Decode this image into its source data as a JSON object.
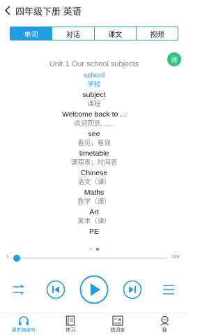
{
  "header": {
    "title": "四年级下册 英语"
  },
  "tabs": [
    {
      "label": "单词",
      "active": true
    },
    {
      "label": "对话",
      "active": false
    },
    {
      "label": "课文",
      "active": false
    },
    {
      "label": "视频",
      "active": false
    }
  ],
  "translate_button": {
    "label": "译"
  },
  "unit_title": "Unit 1 Our school subjects",
  "words": [
    {
      "en": "school",
      "zh": "学校"
    },
    {
      "en": "subject",
      "zh": "课程"
    },
    {
      "en": "Welcome back to ...",
      "zh": "欢迎回到……"
    },
    {
      "en": "see",
      "zh": "看见，看到"
    },
    {
      "en": "timetable",
      "zh": "课程表；时间表"
    },
    {
      "en": "Chinese",
      "zh": "语文（课）"
    },
    {
      "en": "Maths",
      "zh": "数学（课）"
    },
    {
      "en": "Art",
      "zh": "美术（课）"
    },
    {
      "en": "PE",
      "zh": ""
    }
  ],
  "progress": {
    "current": "1",
    "total": "119",
    "fraction": 0.0
  },
  "pager": {
    "pages": 2,
    "current": 2
  },
  "colors": {
    "accent": "#1f9ee0",
    "translate": "#2ec27e"
  },
  "bottom_nav": [
    {
      "label": "课本随身听",
      "icon": "headphones-icon",
      "active": true
    },
    {
      "label": "练习",
      "icon": "book-icon",
      "active": false
    },
    {
      "label": "错词库",
      "icon": "wrong-words-icon",
      "active": false
    },
    {
      "label": "我",
      "icon": "user-icon",
      "active": false
    }
  ]
}
